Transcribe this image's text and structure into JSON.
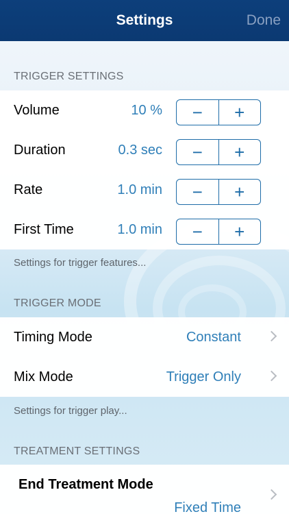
{
  "nav": {
    "title": "Settings",
    "done": "Done"
  },
  "trigger_settings": {
    "header": "TRIGGER SETTINGS",
    "rows": [
      {
        "label": "Volume",
        "value": "10 %"
      },
      {
        "label": "Duration",
        "value": "0.3 sec"
      },
      {
        "label": "Rate",
        "value": "1.0 min"
      },
      {
        "label": "First Time",
        "value": "1.0 min"
      }
    ],
    "minus": "−",
    "plus": "+",
    "footer": "Settings for trigger features..."
  },
  "trigger_mode": {
    "header": "TRIGGER MODE",
    "rows": [
      {
        "label": "Timing Mode",
        "value": "Constant"
      },
      {
        "label": "Mix Mode",
        "value": "Trigger Only"
      }
    ],
    "footer": "Settings for trigger play..."
  },
  "treatment_settings": {
    "header": "TREATMENT SETTINGS",
    "end_label": "End Treatment Mode",
    "end_value": "Fixed Time"
  },
  "colors": {
    "nav_bg": "#0d3f7b",
    "accent": "#1d6ca8",
    "value_text": "#2f7fb8"
  }
}
